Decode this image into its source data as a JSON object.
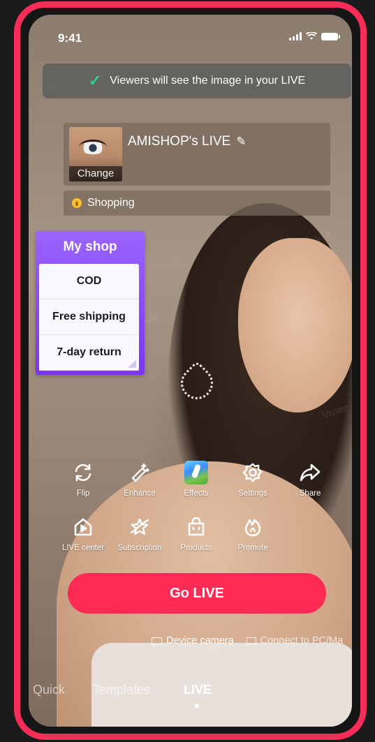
{
  "status_bar": {
    "time": "9:41"
  },
  "toast": {
    "text": "Viewers will see the image in your LIVE"
  },
  "header_faint": {
    "behind_text": "Device camera"
  },
  "title_card": {
    "change_label": "Change",
    "live_title": "AMISHOP's LIVE"
  },
  "shopping": {
    "label": "Shopping"
  },
  "my_shop": {
    "title": "My shop",
    "items": [
      "COD",
      "Free shipping",
      "7-day return"
    ]
  },
  "tools_row1": [
    {
      "label": "Flip",
      "icon": "flip-icon"
    },
    {
      "label": "Enhance",
      "icon": "enhance-icon"
    },
    {
      "label": "Effects",
      "icon": "effects-icon"
    },
    {
      "label": "Settings",
      "icon": "settings-icon"
    },
    {
      "label": "Share",
      "icon": "share-icon"
    }
  ],
  "tools_row2": [
    {
      "label": "LIVE center",
      "icon": "live-center-icon"
    },
    {
      "label": "Subscription",
      "icon": "subscription-icon"
    },
    {
      "label": "Products",
      "icon": "products-icon"
    },
    {
      "label": "Promote",
      "icon": "promote-icon"
    }
  ],
  "go_live": {
    "label": "Go LIVE"
  },
  "camera_options": {
    "device_camera": "Device camera",
    "connect_pc": "Connect to PC/Ma"
  },
  "mode_tabs": {
    "quick": "Quick",
    "templates": "Templates",
    "live": "LIVE"
  },
  "colors": {
    "accent": "#fe2c55",
    "frame": "#f52d58",
    "shop_purple": "#8a4bf7",
    "toast_check": "#2fd38a"
  }
}
